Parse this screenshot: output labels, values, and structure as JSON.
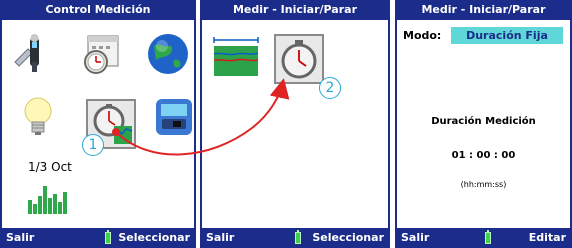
{
  "screens": [
    {
      "title": "Control Medición",
      "footer_left": "Salir",
      "footer_right": "Seleccionar"
    },
    {
      "title": "Medir - Iniciar/Parar",
      "footer_left": "Salir",
      "footer_right": "Seleccionar"
    },
    {
      "title": "Medir - Iniciar/Parar",
      "footer_left": "Salir",
      "footer_right": "Editar"
    }
  ],
  "menu_icons": [
    "sound-meter-tool-icon",
    "calendar-timer-icon",
    "globe-icon",
    "light-bulb-icon",
    "measure-control-icon",
    "instrument-device-icon",
    "history-chart-icon"
  ],
  "history_label": "1/3 Oct",
  "callouts": [
    "1",
    "2"
  ],
  "mode": {
    "label": "Modo:",
    "value": "Duración Fija"
  },
  "duration": {
    "title": "Duración Medición",
    "value": "01 : 00 : 00",
    "unit": "(hh:mm:ss)"
  },
  "colors": {
    "header": "#1b2c8a",
    "mode_bg": "#5fd6d7",
    "arrow": "#e02424",
    "callout": "#2aa7d6",
    "battery": "#3ed14b"
  }
}
